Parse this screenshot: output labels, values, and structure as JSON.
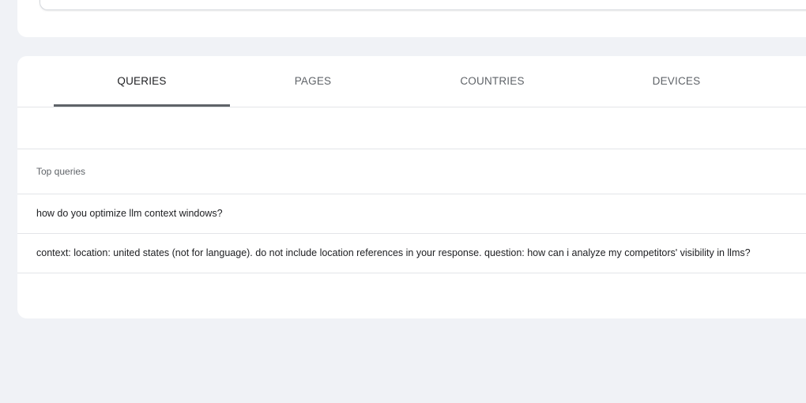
{
  "tabs": [
    {
      "label": "QUERIES",
      "active": true
    },
    {
      "label": "PAGES",
      "active": false
    },
    {
      "label": "COUNTRIES",
      "active": false
    },
    {
      "label": "DEVICES",
      "active": false
    }
  ],
  "table": {
    "header": "Top queries",
    "rows": [
      {
        "query": "how do you optimize llm context windows?"
      },
      {
        "query": "context: location: united states (not for language). do not include location references in your response. question: how can i analyze my competitors' visibility in llms?"
      }
    ]
  },
  "colors": {
    "background": "#f0f2f6",
    "card": "#ffffff",
    "active_indicator": "#5f6368",
    "divider": "#e3e5e8"
  }
}
